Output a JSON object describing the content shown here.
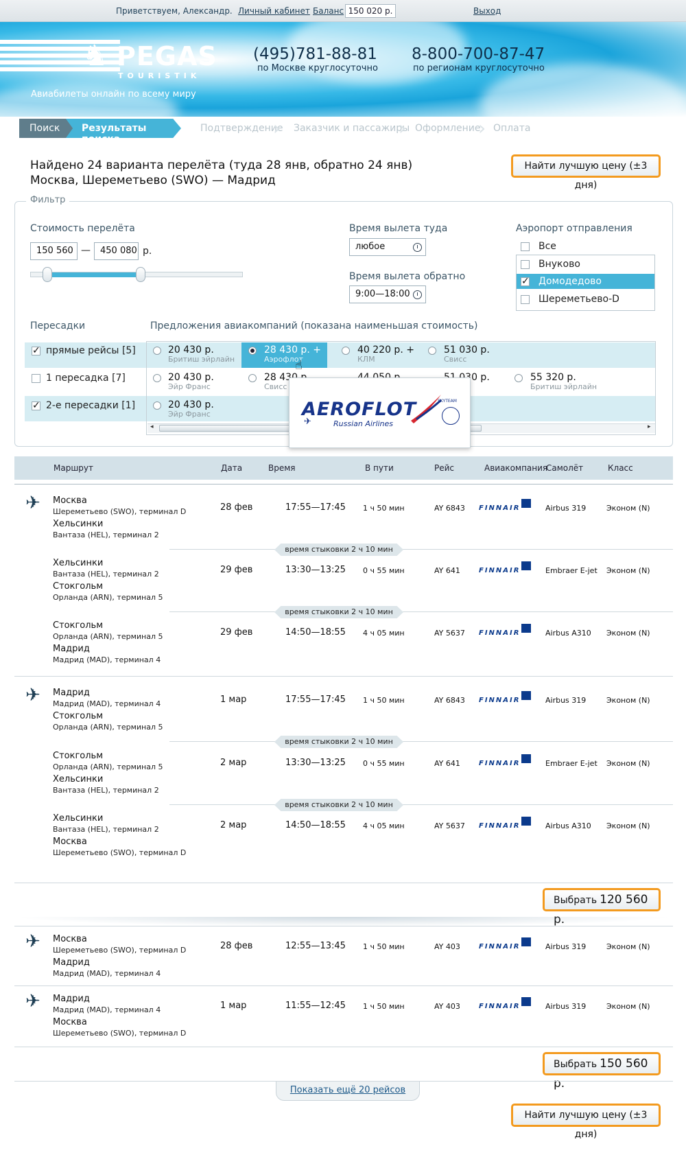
{
  "topbar": {
    "greeting": "Приветствуем, Александр.",
    "cabinet": "Личный кабинет",
    "balance_label": "Баланс",
    "balance_value": "150 020 р.",
    "logout": "Выход"
  },
  "header": {
    "logo": "PEGAS",
    "logo_sub": "TOURISTIK",
    "tagline": "Авиабилеты онлайн по всему миру",
    "phone1": "(495)781-88-81",
    "phone1_sub": "по Москве круглосуточно",
    "phone2": "8-800-700-87-47",
    "phone2_sub": "по регионам круглосуточно"
  },
  "steps": [
    "Поиск",
    "Результаты поиска",
    "Подтверждение",
    "Заказчик и пассажиры",
    "Оформление",
    "Оплата"
  ],
  "title": {
    "found": "Найдено 24 варианта перелёта (туда 28 янв, обратно 24 янв)",
    "route": "Москва,  Шереметьево (SWO) — Мадрид",
    "best_price": "Найти лучшую цену (±3 дня)"
  },
  "filter": {
    "legend": "Фильтр",
    "cost_label": "Стоимость перелёта",
    "cost_from": "150 560",
    "cost_dash": "—",
    "cost_to": "450 080",
    "currency": "р.",
    "price_range_fill": [
      0.08,
      0.52
    ],
    "dep_time_label": "Время вылета туда",
    "dep_time_value": "любое",
    "ret_time_label": "Время вылета обратно",
    "ret_time_value": "9:00—18:00",
    "airport_label": "Аэропорт отправления",
    "airports": [
      {
        "label": "Все",
        "checked": false
      },
      {
        "label": "Внуково",
        "checked": false
      },
      {
        "label": "Домодедово",
        "checked": true
      },
      {
        "label": "Шереметьево-D",
        "checked": false
      }
    ],
    "stops_label": "Пересадки",
    "offers_label": "Предложения авиакомпаний (показана наименьшая стоимость)",
    "stops": [
      {
        "label": "прямые рейсы [5]",
        "checked": true
      },
      {
        "label": "1 пересадка [7]",
        "checked": false
      },
      {
        "label": "2-е пересадки [1]",
        "checked": true
      }
    ],
    "offers_row1": [
      {
        "price": "20 430 р.",
        "airline": "Бритиш эйрлайн"
      },
      {
        "price": "28 430 р. +",
        "airline": "Аэрофлот"
      },
      {
        "price": "40 220 р. +",
        "airline": "КЛМ"
      },
      {
        "price": "51 030 р.",
        "airline": "Свисс"
      }
    ],
    "offers_row2": [
      {
        "price": "20 430 р.",
        "airline": "Эйр Франс"
      },
      {
        "price": "28 430 р.",
        "airline": "Свисс"
      },
      {
        "price": "44 050 р.",
        "airline": ""
      },
      {
        "price": "51 030 р.",
        "airline": ""
      },
      {
        "price": "55 320 р.",
        "airline": "Бритиш эйрлайн"
      }
    ],
    "offers_row3": [
      {
        "price": "20 430 р.",
        "airline": "Эйр Франс"
      }
    ],
    "tooltip_logo": "AEROFLOT",
    "tooltip_sub": "Russian Airlines",
    "tooltip_badge": "SKYTEAM"
  },
  "table": {
    "headers": [
      "Маршрут",
      "Дата",
      "Время",
      "В пути",
      "Рейс",
      "Авиакомпания",
      "Самолёт",
      "Класс"
    ],
    "connection_text": "время стыковки 2 ч 10 мин",
    "airline_logo": "FINNAIR",
    "option1": {
      "out": [
        {
          "from": "Москва",
          "from_sub": "Шереметьево (SWO), терминал D",
          "to": "Хельсинки",
          "to_sub": "Вантаза (HEL), терминал 2",
          "date": "28 фев",
          "time": "17:55—17:45",
          "dur": "1 ч 50 мин",
          "flight": "AY 6843",
          "plane": "Airbus 319",
          "class": "Эконом (N)"
        },
        {
          "from": "Хельсинки",
          "from_sub": "Вантаза (HEL), терминал 2",
          "to": "Стокгольм",
          "to_sub": "Орланда (ARN), терминал 5",
          "date": "29 фев",
          "time": "13:30—13:25",
          "dur": "0 ч 55 мин",
          "flight": "AY 641",
          "plane": "Embraer E-jet",
          "class": "Эконом (N)"
        },
        {
          "from": "Стокгольм",
          "from_sub": "Орланда (ARN), терминал 5",
          "to": "Мадрид",
          "to_sub": "Мадрид (MAD), терминал 4",
          "date": "29 фев",
          "time": "14:50—18:55",
          "dur": "4 ч 05 мин",
          "flight": "AY 5637",
          "plane": "Airbus A310",
          "class": "Эконом (N)"
        }
      ],
      "back": [
        {
          "from": "Мадрид",
          "from_sub": "Мадрид (MAD), терминал 4",
          "to": "Стокгольм",
          "to_sub": "Орланда (ARN), терминал 5",
          "date": "1 мар",
          "time": "17:55—17:45",
          "dur": "1 ч 50 мин",
          "flight": "AY 6843",
          "plane": "Airbus 319",
          "class": "Эконом (N)"
        },
        {
          "from": "Стокгольм",
          "from_sub": "Орланда (ARN), терминал 5",
          "to": "Хельсинки",
          "to_sub": "Вантаза (HEL), терминал 2",
          "date": "2 мар",
          "time": "13:30—13:25",
          "dur": "0 ч 55 мин",
          "flight": "AY 641",
          "plane": "Embraer E-jet",
          "class": "Эконом (N)"
        },
        {
          "from": "Хельсинки",
          "from_sub": "Вантаза (HEL), терминал 2",
          "to": "Москва",
          "to_sub": "Шереметьево (SWO), терминал D",
          "date": "2 мар",
          "time": "14:50—18:55",
          "dur": "4 ч 05 мин",
          "flight": "AY 5637",
          "plane": "Airbus A310",
          "class": "Эконом (N)"
        }
      ],
      "choose_label": "Выбрать",
      "price": "120 560 р."
    },
    "option2": {
      "out": {
        "from": "Москва",
        "from_sub": "Шереметьево (SWO), терминал D",
        "to": "Мадрид",
        "to_sub": "Мадрид (MAD), терминал 4",
        "date": "28 фев",
        "time": "12:55—13:45",
        "dur": "1 ч 50 мин",
        "flight": "AY 403",
        "plane": "Airbus 319",
        "class": "Эконом (N)"
      },
      "back": {
        "from": "Мадрид",
        "from_sub": "Мадрид (MAD), терминал 4",
        "to": "Москва",
        "to_sub": "Шереметьево (SWO), терминал D",
        "date": "1 мар",
        "time": "11:55—12:45",
        "dur": "1 ч 50 мин",
        "flight": "AY 403",
        "plane": "Airbus 319",
        "class": "Эконом (N)"
      },
      "choose_label": "Выбрать",
      "price": "150 560 р."
    },
    "more": "Показать ещё 20 рейсов"
  },
  "colors": {
    "accent": "#45b4d8",
    "orange": "#f39a1e",
    "header_blue": "#1aa4db"
  }
}
